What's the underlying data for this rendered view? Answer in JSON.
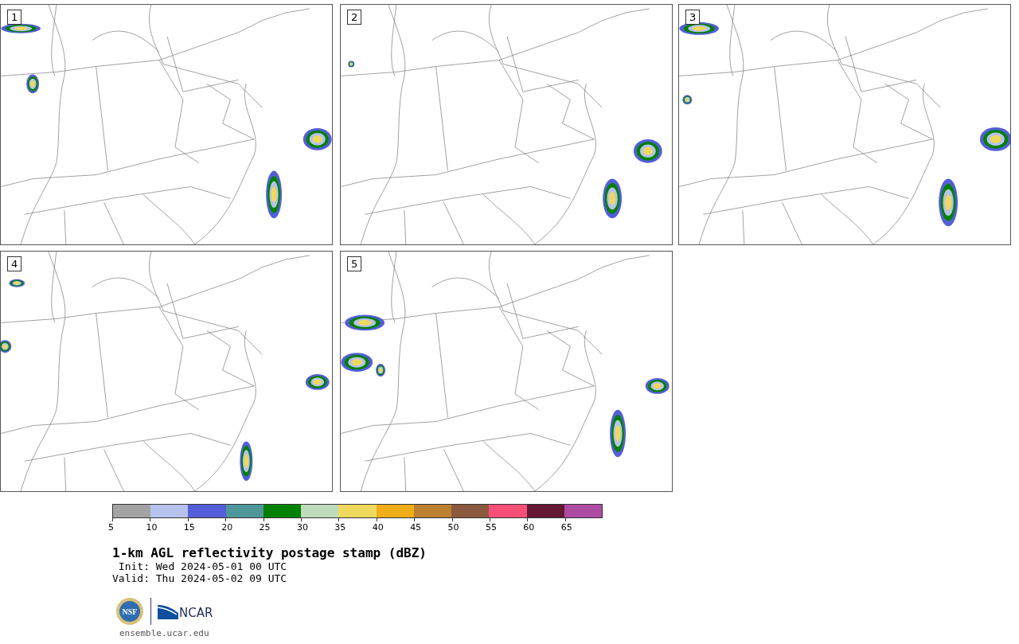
{
  "panels": [
    {
      "label": "1"
    },
    {
      "label": "2"
    },
    {
      "label": "3"
    },
    {
      "label": "4"
    },
    {
      "label": "5"
    }
  ],
  "colorbar": {
    "segments": [
      {
        "label": "5",
        "color": "#a3a3a3"
      },
      {
        "label": "10",
        "color": "#b6c1ec"
      },
      {
        "label": "15",
        "color": "#535ed8"
      },
      {
        "label": "20",
        "color": "#4f969a"
      },
      {
        "label": "25",
        "color": "#008200"
      },
      {
        "label": "30",
        "color": "#bedcbc"
      },
      {
        "label": "35",
        "color": "#eed95c"
      },
      {
        "label": "40",
        "color": "#efad18"
      },
      {
        "label": "45",
        "color": "#bc8032"
      },
      {
        "label": "50",
        "color": "#8b5a3e"
      },
      {
        "label": "55",
        "color": "#f54f78"
      },
      {
        "label": "60",
        "color": "#641833"
      },
      {
        "label": "65",
        "color": "#ad4ba2"
      }
    ]
  },
  "title": "1-km AGL reflectivity postage stamp (dBZ)",
  "init": " Init: Wed 2024-05-01 00 UTC",
  "valid": "Valid: Thu 2024-05-02 09 UTC",
  "logos": {
    "nsf": "NSF",
    "ncar": "NCAR"
  },
  "url": "ensemble.ucar.edu"
}
